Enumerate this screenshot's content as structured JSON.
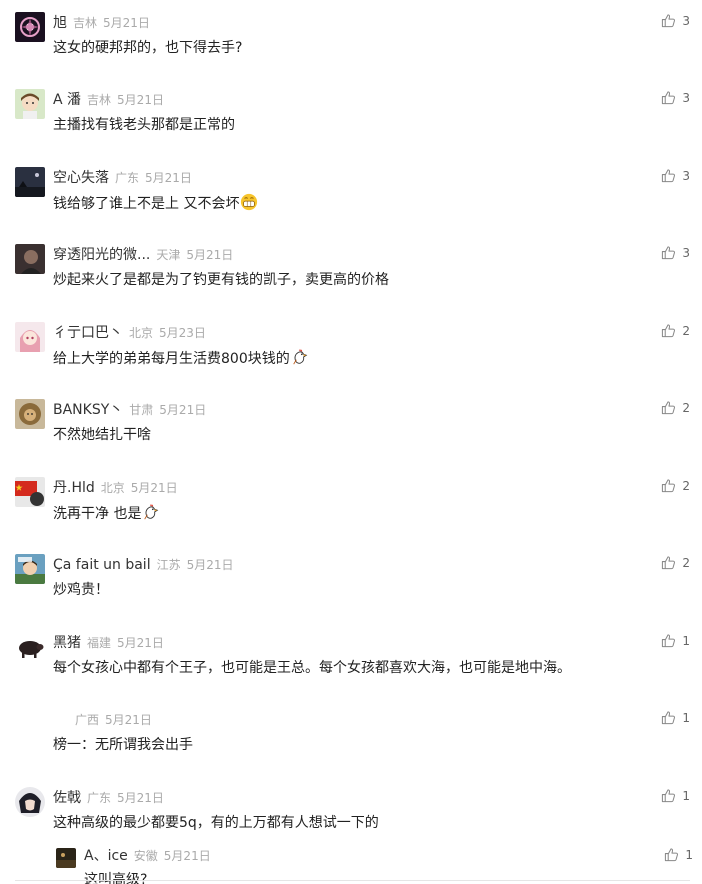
{
  "comments": [
    {
      "name": "旭",
      "location": "吉林",
      "date": "5月21日",
      "text": "这女的硬邦邦的，也下得去手?",
      "likes": "3",
      "avatar": "dark-flower-avatar"
    },
    {
      "name": "A 潘",
      "location": "吉林",
      "date": "5月21日",
      "text": "主播找有钱老头那都是正常的",
      "likes": "3",
      "avatar": "cartoon-girl-avatar"
    },
    {
      "name": "空心失落",
      "location": "广东",
      "date": "5月21日",
      "text": "钱给够了谁上不是上 又不会坏",
      "likes": "3",
      "avatar": "night-scene-avatar",
      "emoji": "grin-emoji"
    },
    {
      "name": "穿透阳光的微...",
      "location": "天津",
      "date": "5月21日",
      "text": "炒起来火了是都是为了钓更有钱的凯子，卖更高的价格",
      "likes": "3",
      "avatar": "portrait-avatar"
    },
    {
      "name": "彳亍口巴丶",
      "location": "北京",
      "date": "5月23日",
      "text": "给上大学的弟弟每月生活费800块钱的",
      "likes": "2",
      "avatar": "anime-girl-avatar",
      "emoji": "chicken-emoji"
    },
    {
      "name": "BANKSY丶",
      "location": "甘肃",
      "date": "5月21日",
      "text": "不然她结扎干啥",
      "likes": "2",
      "avatar": "lion-avatar"
    },
    {
      "name": "丹.Hld",
      "location": "北京",
      "date": "5月21日",
      "text": "洗再干净 也是",
      "likes": "2",
      "avatar": "flag-avatar",
      "emoji": "chicken-emoji"
    },
    {
      "name": "Ça fait un bail",
      "location": "江苏",
      "date": "5月21日",
      "text": "炒鸡贵！",
      "likes": "2",
      "avatar": "cartoon-boy-avatar"
    },
    {
      "name": "黑猪",
      "location": "福建",
      "date": "5月21日",
      "text": "每个女孩心中都有个王子，也可能是王总。每个女孩都喜欢大海，也可能是地中海。",
      "likes": "1",
      "avatar": "black-pig-avatar"
    },
    {
      "name": "",
      "location": "广西",
      "date": "5月21日",
      "text": "榜一：无所谓我会出手",
      "likes": "1",
      "avatar": "blank-avatar"
    },
    {
      "name": "佐戟",
      "location": "广东",
      "date": "5月21日",
      "text": "这种高级的最少都要5q，有的上万都有人想试一下的",
      "likes": "1",
      "avatar": "anime-boy-avatar"
    }
  ],
  "reply": {
    "name": "A、ice",
    "location": "安徽",
    "date": "5月21日",
    "text": "这叫高级?",
    "likes": "1",
    "avatar": "dark-landscape-avatar"
  },
  "colors": {
    "meta": "#aaaaaa",
    "name": "#333333",
    "text": "#222222",
    "like": "#666666"
  }
}
